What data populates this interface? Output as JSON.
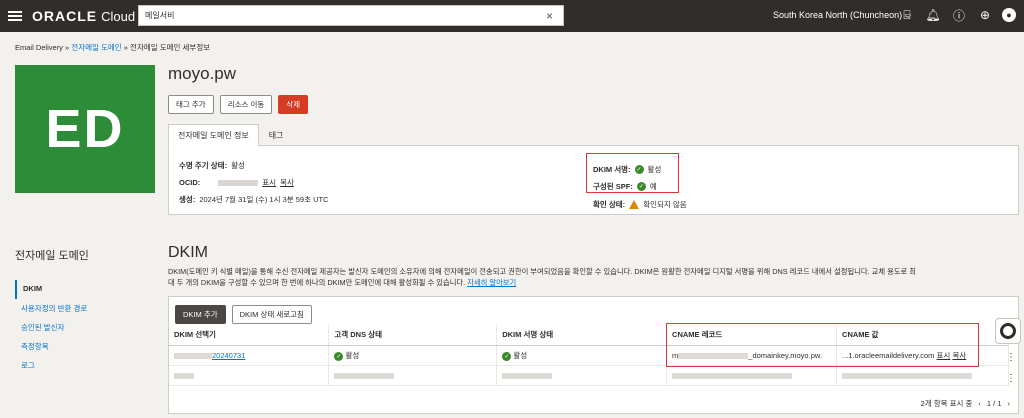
{
  "topbar": {
    "logo_brand": "ORACLE",
    "logo_product": "Cloud",
    "search_value": "메일서비",
    "region": "South Korea North (Chuncheon)",
    "icons": [
      "code-editor-icon",
      "bell-icon",
      "help-icon",
      "globe-icon",
      "user-icon"
    ]
  },
  "breadcrumb": {
    "root": "Email Delivery",
    "parent": "전자메일 도메인",
    "current": "전자메일 도메인 세부정보",
    "sep": "»"
  },
  "tile": {
    "initials": "ED",
    "color": "#2d8c38"
  },
  "title": "moyo.pw",
  "actions": {
    "add_tag": "태그 추가",
    "move": "리소스 이동",
    "delete": "삭제"
  },
  "tabs": [
    "전자메일 도메인 정보",
    "태그"
  ],
  "info": {
    "lifecycle_label": "수명 주기 상태:",
    "lifecycle_value": "활성",
    "ocid_label": "OCID:",
    "show": "표시",
    "copy": "복사",
    "created_label": "생성:",
    "created_value": "2024년 7월 31일 (수) 1시 3분 59초 UTC",
    "dkim_label": "DKIM 서명:",
    "dkim_value": "활성",
    "spf_label": "구성된 SPF:",
    "spf_value": "예",
    "verify_label": "확인 상태:",
    "verify_value": "확인되지 않음"
  },
  "side": {
    "title": "전자메일 도메인",
    "items": [
      "DKIM",
      "사용자정의 반환 경로",
      "승인된 발신자",
      "측정항목",
      "로그"
    ]
  },
  "dkim": {
    "heading": "DKIM",
    "desc1": "DKIM(도메인 키 식별 메일)을 통해 수신 전자메일 제공자는 발신자 도메인의 소유자에 의해 전자메일이 전송되고 권한이 부여되었음을 확인할 수 있습니다. DKIM은 원활한 전자메일 디지털 서명을 위해 DNS 레코드 내에서 설정됩니다. 교체 용도로 최",
    "desc2": "대 두 개의 DKIM을 구성할 수 있으며 한 번에 하나의 DKIM만 도메인에 대해 활성화될 수 있습니다.",
    "learn_more": "자세히 알아보기",
    "add_button": "DKIM 추가",
    "refresh_button": "DKIM 상태 새로고침",
    "columns": [
      "DKIM 선택기",
      "고객 DNS 상태",
      "DKIM 서명 상태",
      "CNAME 레코드",
      "CNAME 값"
    ],
    "row1": {
      "selector_suffix": "20240731",
      "dns_status": "활성",
      "sign_status": "활성",
      "cname_record_prefix": "m",
      "cname_record_suffix": "_domainkey.moyo.pw.",
      "cname_value": "...1.oracleemaildelivery.com",
      "show": "표시",
      "copy": "복사"
    },
    "footer_count": "2개 항목 표시 중",
    "footer_page": "1 / 1"
  },
  "colors": {
    "header": "#312d2a",
    "link": "#0572ce",
    "danger": "#d63b25",
    "highlight": "#e0353b",
    "ok": "#3a8a2c",
    "warn": "#e08700"
  }
}
